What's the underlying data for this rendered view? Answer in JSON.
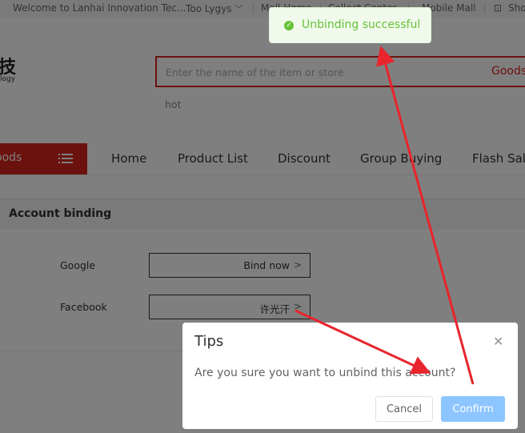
{
  "topbar": {
    "welcome": "Welcome to Lanhai Innovation Tec...",
    "user": "Too Lygys",
    "mall_home": "Mall Home",
    "collect": "Collect Center",
    "mobile_mall": "Mobile Mall",
    "shop": "Sho"
  },
  "header": {
    "logo_char": "技",
    "logo_sub": "logy",
    "search_placeholder": "Enter the name of the item or store",
    "search_button": "Goods",
    "hot": "hot"
  },
  "nav": {
    "goods": "oods",
    "items": [
      "Home",
      "Product List",
      "Discount",
      "Group Buying",
      "Flash Sale"
    ]
  },
  "account": {
    "title": "Account binding",
    "rows": [
      {
        "label": "Google",
        "value": "Bind now"
      },
      {
        "label": "Facebook",
        "value": "许光汗"
      }
    ]
  },
  "toast": {
    "message": "Unbinding successful",
    "color": "#67c23a"
  },
  "dialog": {
    "title": "Tips",
    "message": "Are you sure you want to unbind this account?",
    "cancel": "Cancel",
    "confirm": "Confirm"
  },
  "colors": {
    "brand_red": "#d9251d",
    "annotation_red": "#e8242c",
    "confirm_blue": "#8cc5ff"
  }
}
